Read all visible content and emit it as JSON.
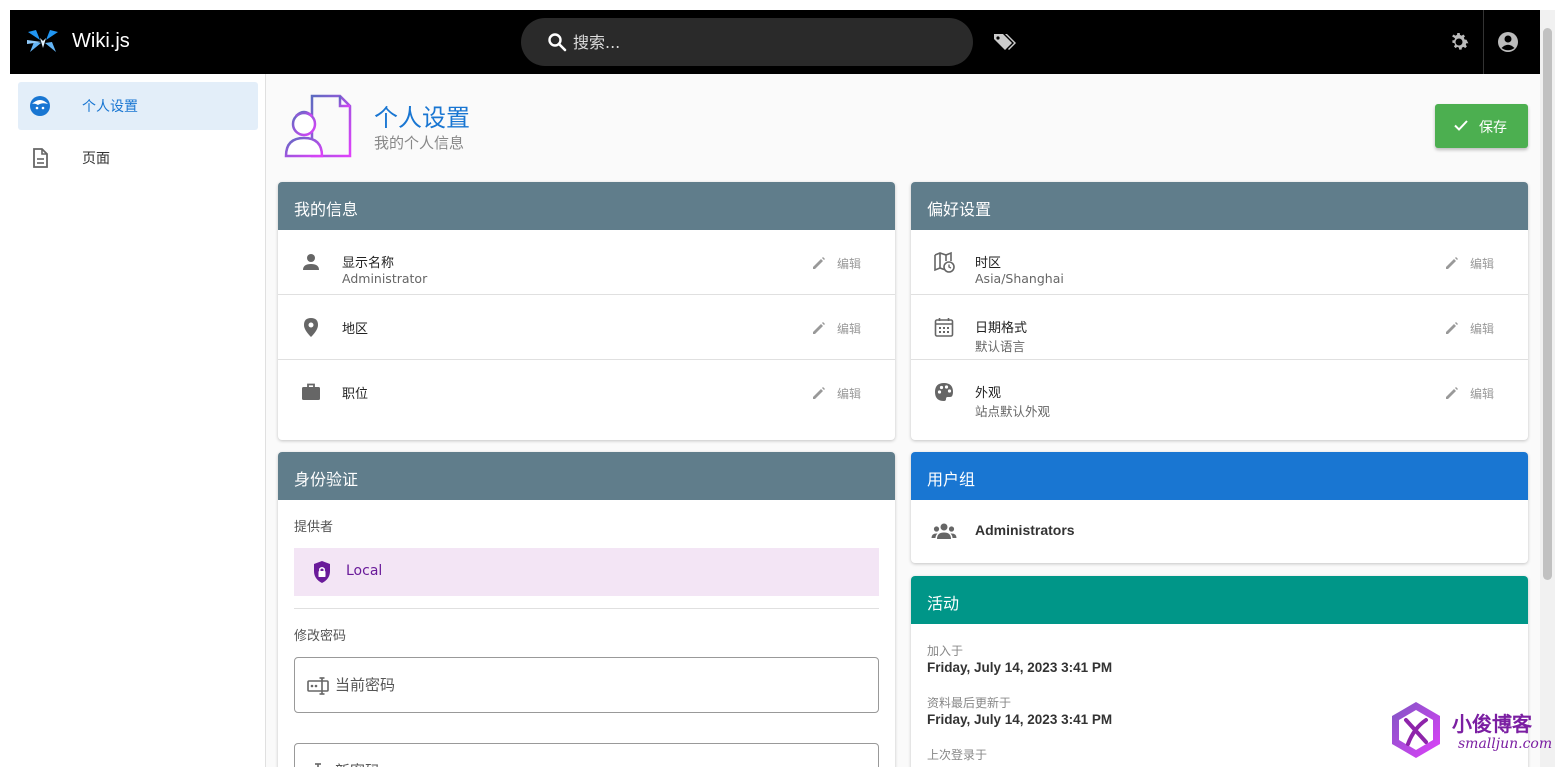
{
  "app": {
    "title": "Wiki.js"
  },
  "search": {
    "placeholder": "搜索..."
  },
  "sidebar": {
    "items": [
      {
        "label": "个人设置",
        "icon": "face-profile-icon",
        "active": true
      },
      {
        "label": "页面",
        "icon": "file-document-icon",
        "active": false
      }
    ]
  },
  "header": {
    "title": "个人设置",
    "subtitle": "我的个人信息",
    "save_label": "保存"
  },
  "my_info": {
    "title": "我的信息",
    "rows": [
      {
        "label": "显示名称",
        "value": "Administrator",
        "icon": "person-icon"
      },
      {
        "label": "地区",
        "value": "",
        "icon": "location-icon"
      },
      {
        "label": "职位",
        "value": "",
        "icon": "briefcase-icon"
      }
    ]
  },
  "preferences": {
    "title": "偏好设置",
    "rows": [
      {
        "label": "时区",
        "value": "Asia/Shanghai",
        "icon": "map-clock-icon"
      },
      {
        "label": "日期格式",
        "value": "默认语言",
        "icon": "calendar-icon"
      },
      {
        "label": "外观",
        "value": "站点默认外观",
        "icon": "palette-icon"
      }
    ]
  },
  "edit_label": "编辑",
  "auth": {
    "title": "身份验证",
    "provider_label": "提供者",
    "provider": "Local",
    "change_password_label": "修改密码",
    "current_password_placeholder": "当前密码",
    "new_password_placeholder": "新密码"
  },
  "groups": {
    "title": "用户组",
    "items": [
      "Administrators"
    ]
  },
  "activity": {
    "title": "活动",
    "joined_label": "加入于",
    "joined_value": "Friday, July 14, 2023 3:41 PM",
    "updated_label": "资料最后更新于",
    "updated_value": "Friday, July 14, 2023 3:41 PM",
    "last_login_label": "上次登录于"
  },
  "watermark": {
    "name": "小俊博客",
    "url": "smalljun.com"
  },
  "colors": {
    "topbar": "#000000",
    "accent": "#1976d2",
    "card_header": "#607d8b",
    "groups_header": "#1976d2",
    "activity_header": "#009688",
    "save": "#4caf50"
  }
}
